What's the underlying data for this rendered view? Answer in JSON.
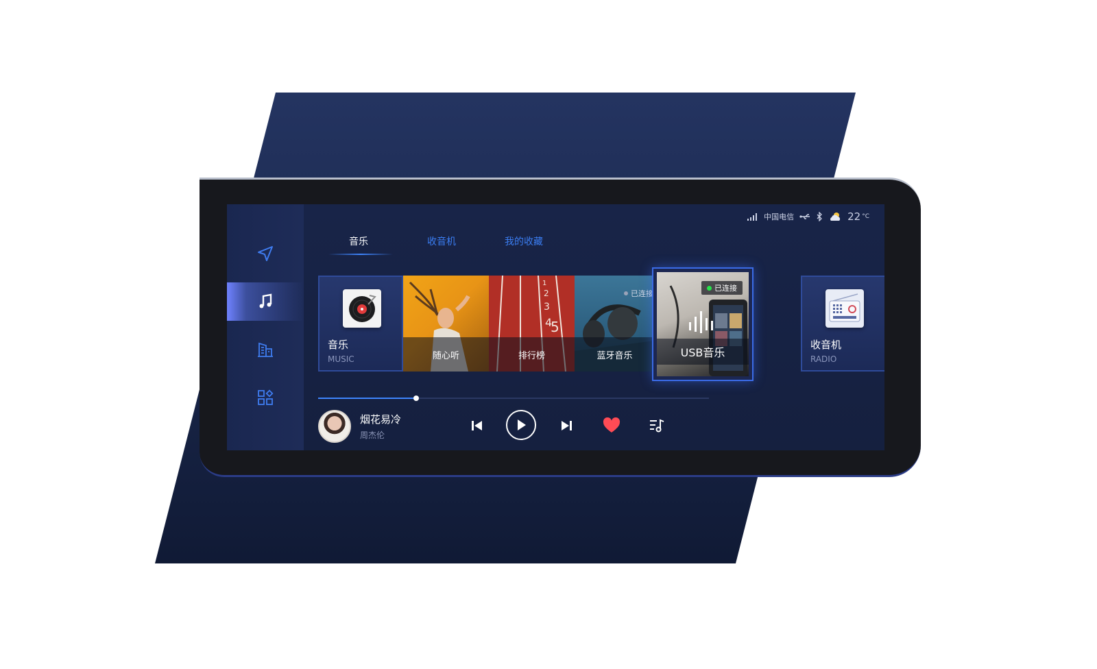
{
  "colors": {
    "accent": "#3f86ff",
    "tab_inactive": "#3b7df1",
    "panel_dark": "#182448",
    "heart": "#ff4b55",
    "connected_dot": "#27e34b"
  },
  "sidebar": {
    "items": [
      {
        "icon": "navigation-icon",
        "active": false
      },
      {
        "icon": "music-note-icon",
        "active": true
      },
      {
        "icon": "building-icon",
        "active": false
      },
      {
        "icon": "apps-icon",
        "active": false
      }
    ]
  },
  "status_bar": {
    "carrier": "中国电信",
    "temperature": "22",
    "temperature_unit": "°C",
    "icons": [
      "signal-icon",
      "usb-icon",
      "bluetooth-icon",
      "weather-cloud-icon"
    ]
  },
  "tabs": [
    {
      "label": "音乐",
      "active": true
    },
    {
      "label": "收音机",
      "active": false
    },
    {
      "label": "我的收藏",
      "active": false
    }
  ],
  "cards": {
    "music": {
      "title": "音乐",
      "subtitle": "MUSIC"
    },
    "random": {
      "label": "随心听"
    },
    "chart": {
      "label": "排行榜"
    },
    "bluetooth": {
      "label": "蓝牙音乐",
      "badge": "已连接"
    },
    "usb": {
      "label": "USB音乐",
      "badge": "已连接"
    },
    "radio": {
      "title": "收音机",
      "subtitle": "RADIO"
    }
  },
  "player": {
    "song": "烟花易冷",
    "artist": "周杰伦",
    "progress": 0.25,
    "liked": true
  }
}
